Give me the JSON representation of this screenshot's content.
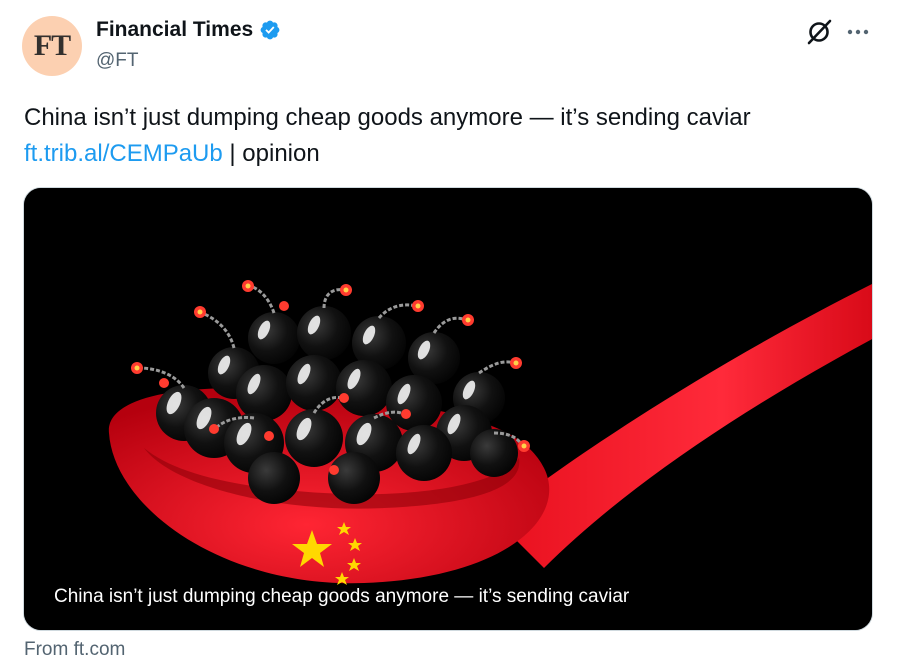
{
  "author": {
    "avatar_text": "FT",
    "display_name": "Financial Times",
    "handle": "@FT",
    "verified_icon": "verified-badge-icon"
  },
  "toolbar": {
    "grok_icon": "grok-icon",
    "more_icon": "more-options-icon"
  },
  "tweet": {
    "text": "China isn’t just dumping cheap goods anymore — it’s sending caviar",
    "link": "ft.trib.al/CEMPaUb",
    "suffix": " | opinion"
  },
  "card": {
    "caption": "China isn’t just dumping cheap goods anymore — it’s sending caviar",
    "source": "From ft.com"
  },
  "colors": {
    "link": "#1d9bf0",
    "spoon_red": "#e8101e",
    "star_yellow": "#ffd800"
  }
}
